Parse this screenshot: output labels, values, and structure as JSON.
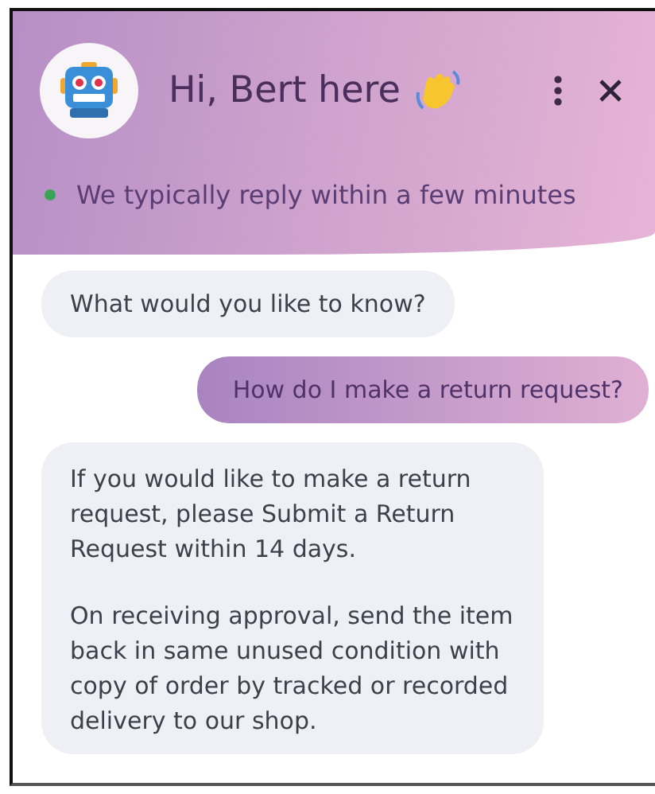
{
  "header": {
    "title": "Hi, Bert here",
    "status": "We typically reply within a few minutes",
    "online": true
  },
  "messages": [
    {
      "kind": "bot",
      "paragraphs": [
        "What would you like to know?"
      ]
    },
    {
      "kind": "user",
      "paragraphs": [
        "How do I make a return request?"
      ]
    },
    {
      "kind": "bot",
      "paragraphs": [
        "If you would like to make a return request, please Submit a Return Request within 14 days.",
        "On receiving approval, send the item back in same unused condition with copy of order by tracked or recorded delivery to our shop."
      ]
    }
  ]
}
